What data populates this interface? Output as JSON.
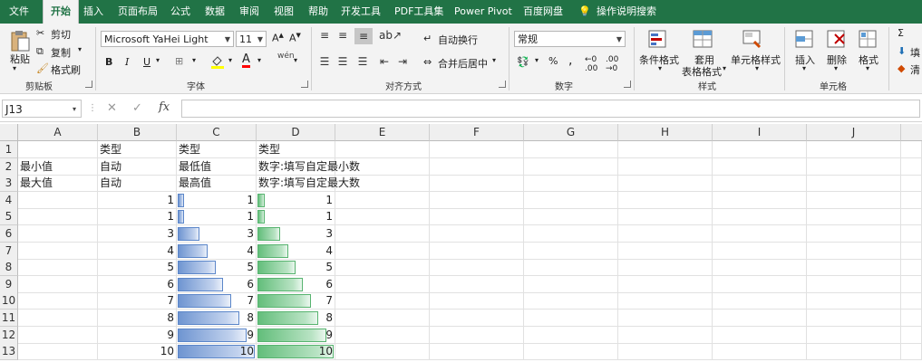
{
  "tabs": [
    "文件",
    "开始",
    "插入",
    "页面布局",
    "公式",
    "数据",
    "审阅",
    "视图",
    "帮助",
    "开发工具",
    "PDF工具集",
    "Power Pivot",
    "百度网盘",
    "操作说明搜索"
  ],
  "active_tab": "开始",
  "ribbon": {
    "clipboard": {
      "paste": "粘贴",
      "cut": "剪切",
      "copy": "复制",
      "format_painter": "格式刷",
      "label": "剪贴板"
    },
    "font": {
      "name": "Microsoft YaHei Light",
      "size": "11",
      "bold": "B",
      "italic": "I",
      "underline": "U",
      "label": "字体",
      "font_color_letter": "A"
    },
    "alignment": {
      "wrap": "自动换行",
      "merge": "合并后居中",
      "label": "对齐方式"
    },
    "number": {
      "format": "常规",
      "label": "数字"
    },
    "styles": {
      "conditional": "条件格式",
      "table_1": "套用",
      "table_2": "表格格式",
      "cell_styles": "单元格样式",
      "label": "样式"
    },
    "cells": {
      "insert": "插入",
      "delete": "删除",
      "format": "格式",
      "label": "单元格"
    },
    "editing": {
      "fill": "填",
      "clear": "清"
    }
  },
  "formula_bar": {
    "name_box": "J13",
    "fx": "fx",
    "cancel": "✕",
    "confirm": "✓",
    "value": ""
  },
  "sheet": {
    "columns": [
      "A",
      "B",
      "C",
      "D",
      "E",
      "F",
      "G",
      "H",
      "I",
      "J"
    ],
    "rows": [
      "1",
      "2",
      "3",
      "4",
      "5",
      "6",
      "7",
      "8",
      "9",
      "10",
      "11",
      "12",
      "13"
    ],
    "text_rows": [
      {
        "a": "",
        "b": "类型",
        "c": "类型",
        "d": "类型"
      },
      {
        "a": "最小值",
        "b": "自动",
        "c": "最低值",
        "d": "数字:填写自定最小数"
      },
      {
        "a": "最大值",
        "b": "自动",
        "c": "最高值",
        "d": "数字:填写自定最大数"
      }
    ],
    "values_b": [
      1,
      1,
      3,
      4,
      5,
      6,
      7,
      8,
      9,
      10
    ],
    "values_c": [
      1,
      1,
      3,
      4,
      5,
      6,
      7,
      8,
      9,
      10
    ],
    "values_d": [
      1,
      1,
      3,
      4,
      5,
      6,
      7,
      8,
      9,
      10
    ],
    "c_bar_min": 1,
    "c_bar_max": 10,
    "d_bar_min": 0,
    "d_bar_max": 10,
    "bar_colors": {
      "c": "#6f95d1",
      "d": "#63be7b"
    }
  }
}
